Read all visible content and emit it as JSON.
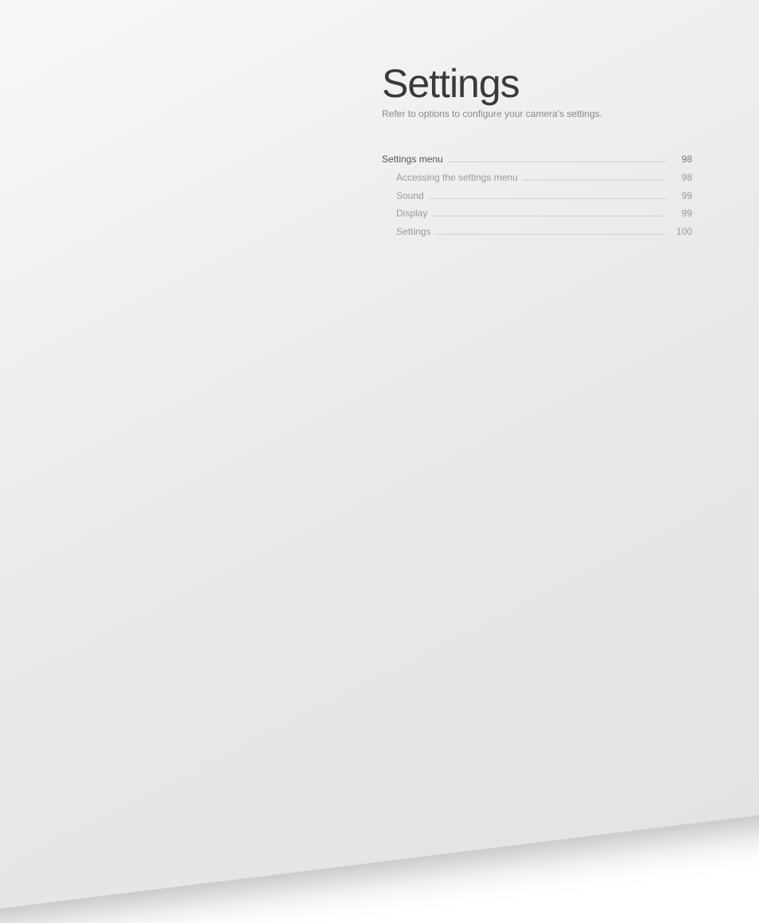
{
  "title": "Settings",
  "subtitle": "Refer to options to configure your camera's settings.",
  "toc": {
    "main": {
      "label": "Settings menu",
      "page": "98"
    },
    "items": [
      {
        "label": "Accessing the settings menu",
        "page": "98"
      },
      {
        "label": "Sound",
        "page": "99"
      },
      {
        "label": "Display",
        "page": "99"
      },
      {
        "label": "Settings",
        "page": "100"
      }
    ]
  }
}
